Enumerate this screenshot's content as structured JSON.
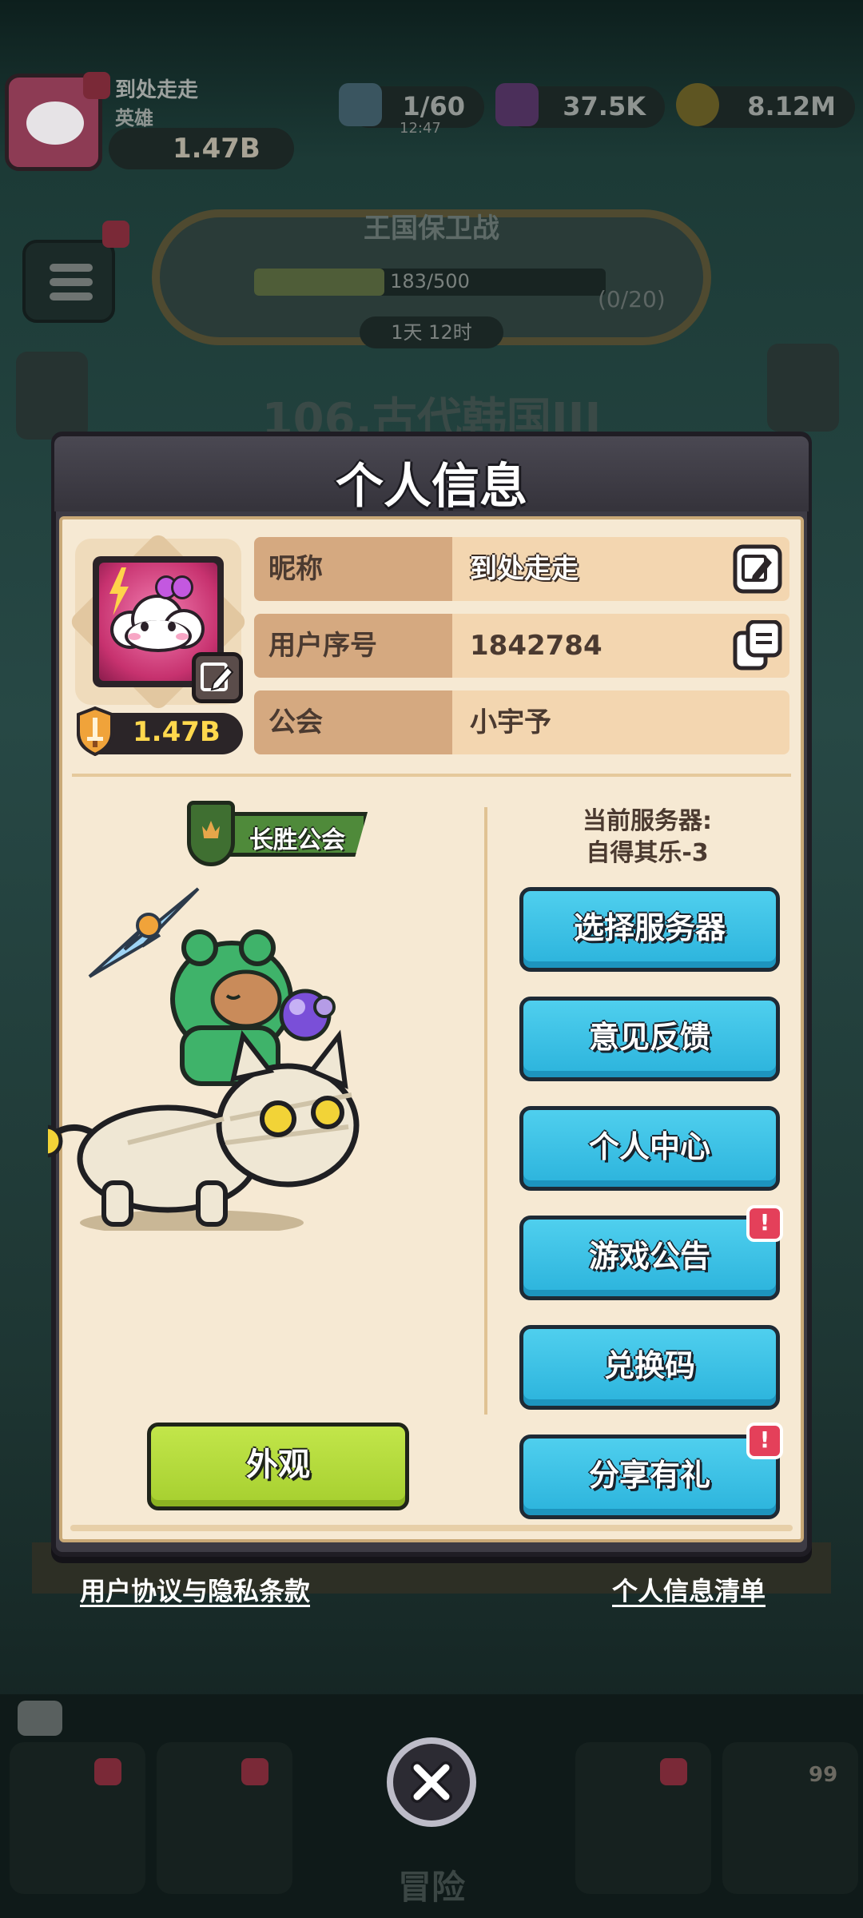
{
  "background": {
    "player_name": "到处走走",
    "player_title": "英雄",
    "power": "1.47B",
    "energy": "1/60",
    "energy_timer": "12:47",
    "gems": "37.5K",
    "gold": "8.12M",
    "event_title": "王国保卫战",
    "event_progress": "183/500",
    "event_count": "(0/20)",
    "event_time": "1天 12时",
    "level_title": "106.古代韩国III",
    "tab_adventure": "冒险",
    "tab_count": "99"
  },
  "modal": {
    "title": "个人信息",
    "power": "1.47B",
    "rows": [
      {
        "label": "昵称",
        "value": "到处走走"
      },
      {
        "label": "用户序号",
        "value": "1842784"
      },
      {
        "label": "公会",
        "value": "小宇予"
      }
    ],
    "guild_badge": "长胜公会",
    "server_label": "当前服务器:",
    "server_name": "自得其乐-3",
    "buttons": [
      {
        "label": "选择服务器",
        "alert": false
      },
      {
        "label": "意见反馈",
        "alert": false
      },
      {
        "label": "个人中心",
        "alert": false
      },
      {
        "label": "游戏公告",
        "alert": true
      },
      {
        "label": "兑换码",
        "alert": false
      },
      {
        "label": "分享有礼",
        "alert": true
      }
    ],
    "alert_symbol": "!",
    "appearance_button": "外观"
  },
  "footer": {
    "privacy_link": "用户协议与隐私条款",
    "info_list_link": "个人信息清单"
  },
  "colors": {
    "blue_button": "#2bb3dc",
    "green_button": "#a6cf2f",
    "alert_badge": "#e4405a",
    "panel": "#f6e9d3"
  },
  "icons": {
    "edit": "pencil-icon",
    "copy": "copy-icon",
    "close": "close-icon",
    "power": "sword-icon"
  }
}
